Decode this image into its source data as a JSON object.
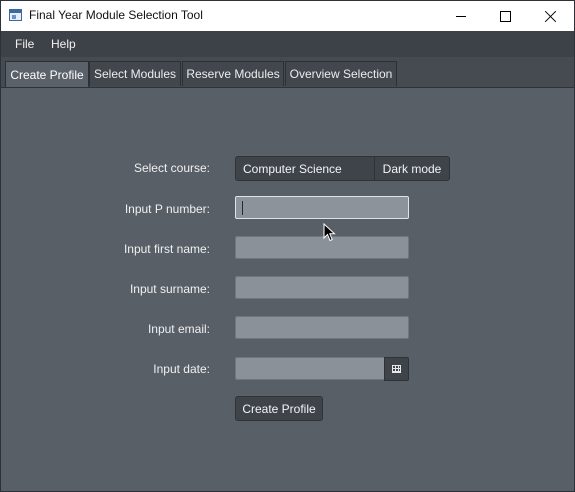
{
  "window": {
    "title": "Final Year Module Selection Tool"
  },
  "menu": {
    "items": [
      "File",
      "Help"
    ]
  },
  "tabs": [
    "Create Profile",
    "Select Modules",
    "Reserve Modules",
    "Overview Selection"
  ],
  "form": {
    "course_label": "Select course:",
    "course_value": "Computer Science",
    "dark_mode_label": "Dark mode",
    "pnumber_label": "Input P number:",
    "pnumber_value": "",
    "firstname_label": "Input first name:",
    "firstname_value": "",
    "surname_label": "Input surname:",
    "surname_value": "",
    "email_label": "Input email:",
    "email_value": "",
    "date_label": "Input date:",
    "date_value": "",
    "submit_label": "Create Profile"
  },
  "icons": {
    "app": "app-window-icon",
    "calendar": "calendar-icon",
    "cursor": "mouse-pointer-icon"
  },
  "colors": {
    "background": "#595f67",
    "control": "#3f444b",
    "field": "#8a9199",
    "text": "#f0f0f0"
  }
}
